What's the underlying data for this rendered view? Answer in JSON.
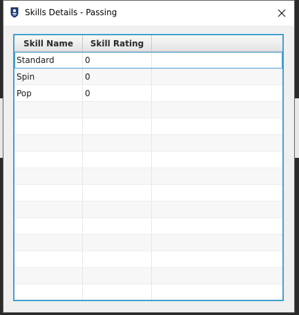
{
  "window": {
    "title": "Skills Details - Passing",
    "app_icon": "team-crest-icon",
    "close_icon": "close-icon"
  },
  "table": {
    "columns": [
      "Skill Name",
      "Skill Rating",
      ""
    ],
    "rows": [
      [
        "Standard",
        "0",
        ""
      ],
      [
        "Spin",
        "0",
        ""
      ],
      [
        "Pop",
        "0",
        ""
      ]
    ],
    "selected_row": 0
  },
  "colors": {
    "accent_border": "#3f9fce"
  }
}
